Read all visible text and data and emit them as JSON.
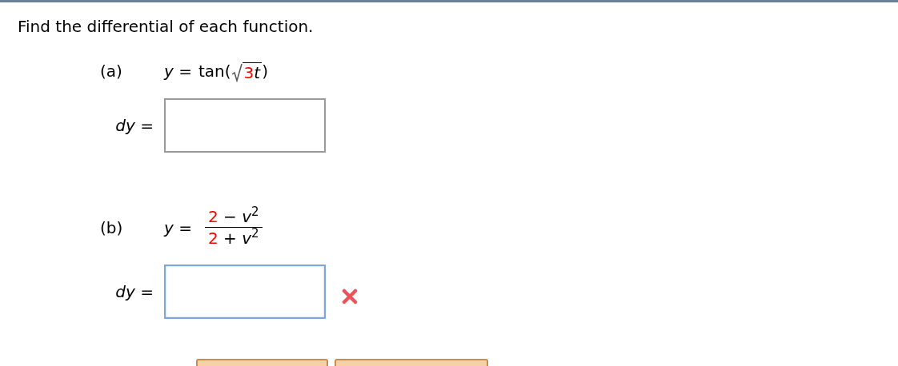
{
  "instruction": "Find the differential of each function.",
  "parts": [
    {
      "label": "(a)",
      "equation": {
        "kind": "sqrt",
        "lhs": "*y* =",
        "head": "tan(",
        "radicand": [
          {
            "text": "3",
            "color": "#ff0000"
          },
          {
            "text": "*t*"
          }
        ],
        "tail": ")"
      },
      "answer": {
        "label": "*dy* =",
        "focused": false
      }
    },
    {
      "label": "(b)",
      "equation": {
        "kind": "fraction",
        "lhs": "*y* =",
        "numerator": [
          {
            "text": "2",
            "color": "#ff0000"
          },
          {
            "text": " − *v*$^{2}$"
          }
        ],
        "denominator": [
          {
            "text": "2",
            "color": "#ff0000"
          },
          {
            "text": " + *v*$^{2}$"
          }
        ]
      },
      "answer": {
        "label": "*dy* =",
        "focused": true,
        "incorrect": true
      }
    }
  ],
  "footer": {
    "buttons": [
      {
        "kind": "cut-off"
      },
      {
        "kind": "cut-off"
      }
    ]
  }
}
